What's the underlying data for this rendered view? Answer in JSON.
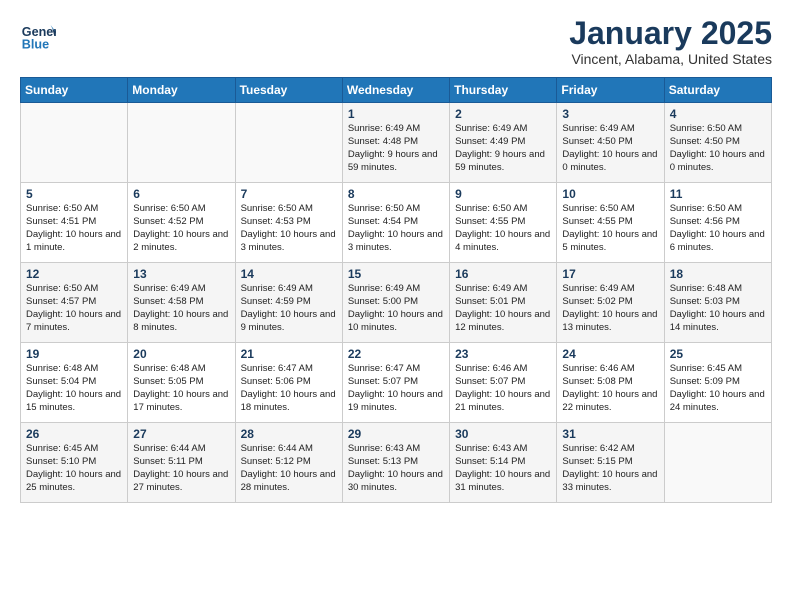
{
  "header": {
    "logo_line1": "General",
    "logo_line2": "Blue",
    "title": "January 2025",
    "location": "Vincent, Alabama, United States"
  },
  "days_of_week": [
    "Sunday",
    "Monday",
    "Tuesday",
    "Wednesday",
    "Thursday",
    "Friday",
    "Saturday"
  ],
  "weeks": [
    [
      {
        "day": "",
        "info": ""
      },
      {
        "day": "",
        "info": ""
      },
      {
        "day": "",
        "info": ""
      },
      {
        "day": "1",
        "info": "Sunrise: 6:49 AM\nSunset: 4:48 PM\nDaylight: 9 hours and 59 minutes."
      },
      {
        "day": "2",
        "info": "Sunrise: 6:49 AM\nSunset: 4:49 PM\nDaylight: 9 hours and 59 minutes."
      },
      {
        "day": "3",
        "info": "Sunrise: 6:49 AM\nSunset: 4:50 PM\nDaylight: 10 hours and 0 minutes."
      },
      {
        "day": "4",
        "info": "Sunrise: 6:50 AM\nSunset: 4:50 PM\nDaylight: 10 hours and 0 minutes."
      }
    ],
    [
      {
        "day": "5",
        "info": "Sunrise: 6:50 AM\nSunset: 4:51 PM\nDaylight: 10 hours and 1 minute."
      },
      {
        "day": "6",
        "info": "Sunrise: 6:50 AM\nSunset: 4:52 PM\nDaylight: 10 hours and 2 minutes."
      },
      {
        "day": "7",
        "info": "Sunrise: 6:50 AM\nSunset: 4:53 PM\nDaylight: 10 hours and 3 minutes."
      },
      {
        "day": "8",
        "info": "Sunrise: 6:50 AM\nSunset: 4:54 PM\nDaylight: 10 hours and 3 minutes."
      },
      {
        "day": "9",
        "info": "Sunrise: 6:50 AM\nSunset: 4:55 PM\nDaylight: 10 hours and 4 minutes."
      },
      {
        "day": "10",
        "info": "Sunrise: 6:50 AM\nSunset: 4:55 PM\nDaylight: 10 hours and 5 minutes."
      },
      {
        "day": "11",
        "info": "Sunrise: 6:50 AM\nSunset: 4:56 PM\nDaylight: 10 hours and 6 minutes."
      }
    ],
    [
      {
        "day": "12",
        "info": "Sunrise: 6:50 AM\nSunset: 4:57 PM\nDaylight: 10 hours and 7 minutes."
      },
      {
        "day": "13",
        "info": "Sunrise: 6:49 AM\nSunset: 4:58 PM\nDaylight: 10 hours and 8 minutes."
      },
      {
        "day": "14",
        "info": "Sunrise: 6:49 AM\nSunset: 4:59 PM\nDaylight: 10 hours and 9 minutes."
      },
      {
        "day": "15",
        "info": "Sunrise: 6:49 AM\nSunset: 5:00 PM\nDaylight: 10 hours and 10 minutes."
      },
      {
        "day": "16",
        "info": "Sunrise: 6:49 AM\nSunset: 5:01 PM\nDaylight: 10 hours and 12 minutes."
      },
      {
        "day": "17",
        "info": "Sunrise: 6:49 AM\nSunset: 5:02 PM\nDaylight: 10 hours and 13 minutes."
      },
      {
        "day": "18",
        "info": "Sunrise: 6:48 AM\nSunset: 5:03 PM\nDaylight: 10 hours and 14 minutes."
      }
    ],
    [
      {
        "day": "19",
        "info": "Sunrise: 6:48 AM\nSunset: 5:04 PM\nDaylight: 10 hours and 15 minutes."
      },
      {
        "day": "20",
        "info": "Sunrise: 6:48 AM\nSunset: 5:05 PM\nDaylight: 10 hours and 17 minutes."
      },
      {
        "day": "21",
        "info": "Sunrise: 6:47 AM\nSunset: 5:06 PM\nDaylight: 10 hours and 18 minutes."
      },
      {
        "day": "22",
        "info": "Sunrise: 6:47 AM\nSunset: 5:07 PM\nDaylight: 10 hours and 19 minutes."
      },
      {
        "day": "23",
        "info": "Sunrise: 6:46 AM\nSunset: 5:07 PM\nDaylight: 10 hours and 21 minutes."
      },
      {
        "day": "24",
        "info": "Sunrise: 6:46 AM\nSunset: 5:08 PM\nDaylight: 10 hours and 22 minutes."
      },
      {
        "day": "25",
        "info": "Sunrise: 6:45 AM\nSunset: 5:09 PM\nDaylight: 10 hours and 24 minutes."
      }
    ],
    [
      {
        "day": "26",
        "info": "Sunrise: 6:45 AM\nSunset: 5:10 PM\nDaylight: 10 hours and 25 minutes."
      },
      {
        "day": "27",
        "info": "Sunrise: 6:44 AM\nSunset: 5:11 PM\nDaylight: 10 hours and 27 minutes."
      },
      {
        "day": "28",
        "info": "Sunrise: 6:44 AM\nSunset: 5:12 PM\nDaylight: 10 hours and 28 minutes."
      },
      {
        "day": "29",
        "info": "Sunrise: 6:43 AM\nSunset: 5:13 PM\nDaylight: 10 hours and 30 minutes."
      },
      {
        "day": "30",
        "info": "Sunrise: 6:43 AM\nSunset: 5:14 PM\nDaylight: 10 hours and 31 minutes."
      },
      {
        "day": "31",
        "info": "Sunrise: 6:42 AM\nSunset: 5:15 PM\nDaylight: 10 hours and 33 minutes."
      },
      {
        "day": "",
        "info": ""
      }
    ]
  ]
}
